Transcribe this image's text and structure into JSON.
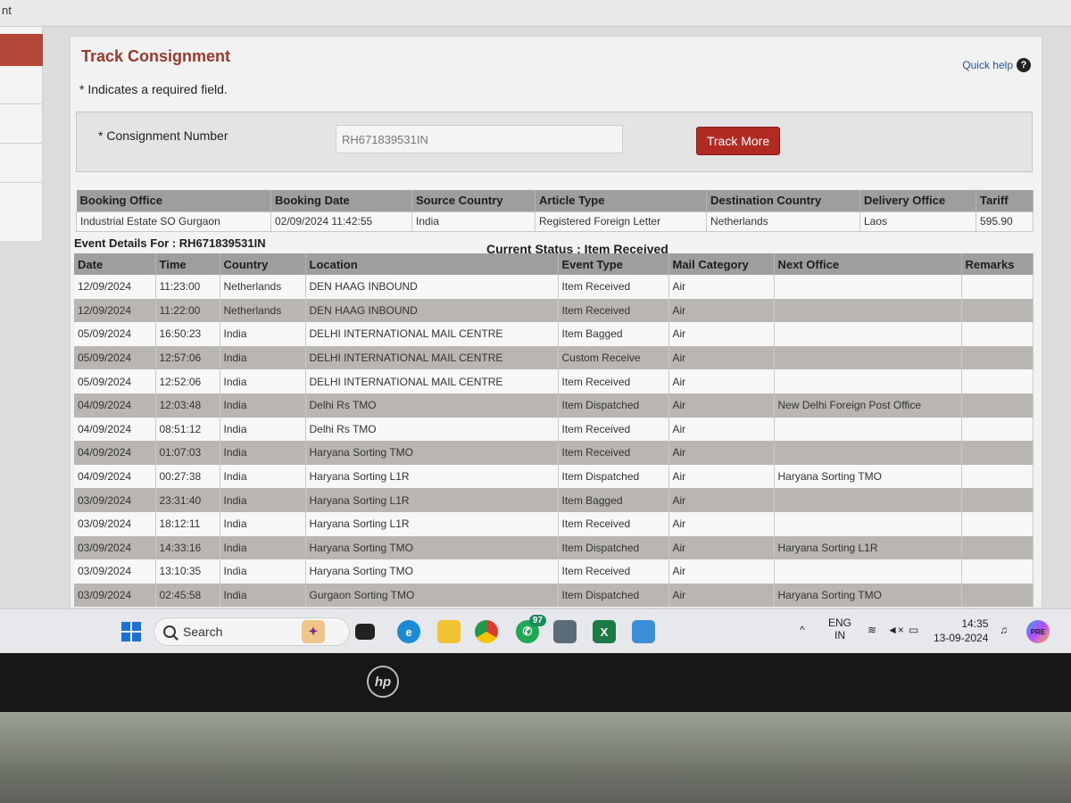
{
  "browser": {
    "tab_fragment": "nt"
  },
  "page": {
    "title": "Track Consignment",
    "required_note": "* Indicates a required field.",
    "quick_help": "Quick help",
    "help_glyph": "?"
  },
  "form": {
    "label": "* Consignment Number",
    "value": "RH671839531IN",
    "button": "Track More"
  },
  "booking": {
    "headers": [
      "Booking Office",
      "Booking Date",
      "Source Country",
      "Article Type",
      "Destination Country",
      "Delivery Office",
      "Tariff"
    ],
    "values": [
      "Industrial Estate SO Gurgaon",
      "02/09/2024 11:42:55",
      "India",
      "Registered Foreign Letter",
      "Netherlands",
      "Laos",
      "595.90"
    ]
  },
  "events": {
    "for_label": "Event Details For : RH671839531IN",
    "current_status": "Current Status : Item Received",
    "headers": [
      "Date",
      "Time",
      "Country",
      "Location",
      "Event Type",
      "Mail Category",
      "Next Office",
      "Remarks"
    ],
    "rows": [
      [
        "12/09/2024",
        "11:23:00",
        "Netherlands",
        "DEN HAAG INBOUND",
        "Item Received",
        "Air",
        "",
        ""
      ],
      [
        "12/09/2024",
        "11:22:00",
        "Netherlands",
        "DEN HAAG INBOUND",
        "Item Received",
        "Air",
        "",
        ""
      ],
      [
        "05/09/2024",
        "16:50:23",
        "India",
        "DELHI INTERNATIONAL MAIL CENTRE",
        "Item Bagged",
        "Air",
        "",
        ""
      ],
      [
        "05/09/2024",
        "12:57:06",
        "India",
        "DELHI INTERNATIONAL MAIL CENTRE",
        "Custom Receive",
        "Air",
        "",
        ""
      ],
      [
        "05/09/2024",
        "12:52:06",
        "India",
        "DELHI INTERNATIONAL MAIL CENTRE",
        "Item Received",
        "Air",
        "",
        ""
      ],
      [
        "04/09/2024",
        "12:03:48",
        "India",
        "Delhi Rs TMO",
        "Item Dispatched",
        "Air",
        "New Delhi Foreign Post Office",
        ""
      ],
      [
        "04/09/2024",
        "08:51:12",
        "India",
        "Delhi Rs TMO",
        "Item Received",
        "Air",
        "",
        ""
      ],
      [
        "04/09/2024",
        "01:07:03",
        "India",
        "Haryana Sorting TMO",
        "Item Received",
        "Air",
        "",
        ""
      ],
      [
        "04/09/2024",
        "00:27:38",
        "India",
        "Haryana Sorting L1R",
        "Item Dispatched",
        "Air",
        "Haryana Sorting TMO",
        ""
      ],
      [
        "03/09/2024",
        "23:31:40",
        "India",
        "Haryana Sorting L1R",
        "Item Bagged",
        "Air",
        "",
        ""
      ],
      [
        "03/09/2024",
        "18:12:11",
        "India",
        "Haryana Sorting L1R",
        "Item Received",
        "Air",
        "",
        ""
      ],
      [
        "03/09/2024",
        "14:33:16",
        "India",
        "Haryana Sorting TMO",
        "Item Dispatched",
        "Air",
        "Haryana Sorting L1R",
        ""
      ],
      [
        "03/09/2024",
        "13:10:35",
        "India",
        "Haryana Sorting TMO",
        "Item Received",
        "Air",
        "",
        ""
      ],
      [
        "03/09/2024",
        "02:45:58",
        "India",
        "Gurgaon Sorting TMO",
        "Item Dispatched",
        "Air",
        "Haryana Sorting TMO",
        ""
      ]
    ]
  },
  "taskbar": {
    "search": "Search",
    "whatsapp_badge": "97",
    "lang_top": "ENG",
    "lang_bottom": "IN",
    "time": "14:35",
    "date": "13-09-2024",
    "copilot_badge": "PRE"
  },
  "laptop": {
    "brand": "hp"
  },
  "colors": {
    "accent": "#b02a22",
    "title": "#9a3a2c",
    "header_bg": "#9e9e9e"
  }
}
